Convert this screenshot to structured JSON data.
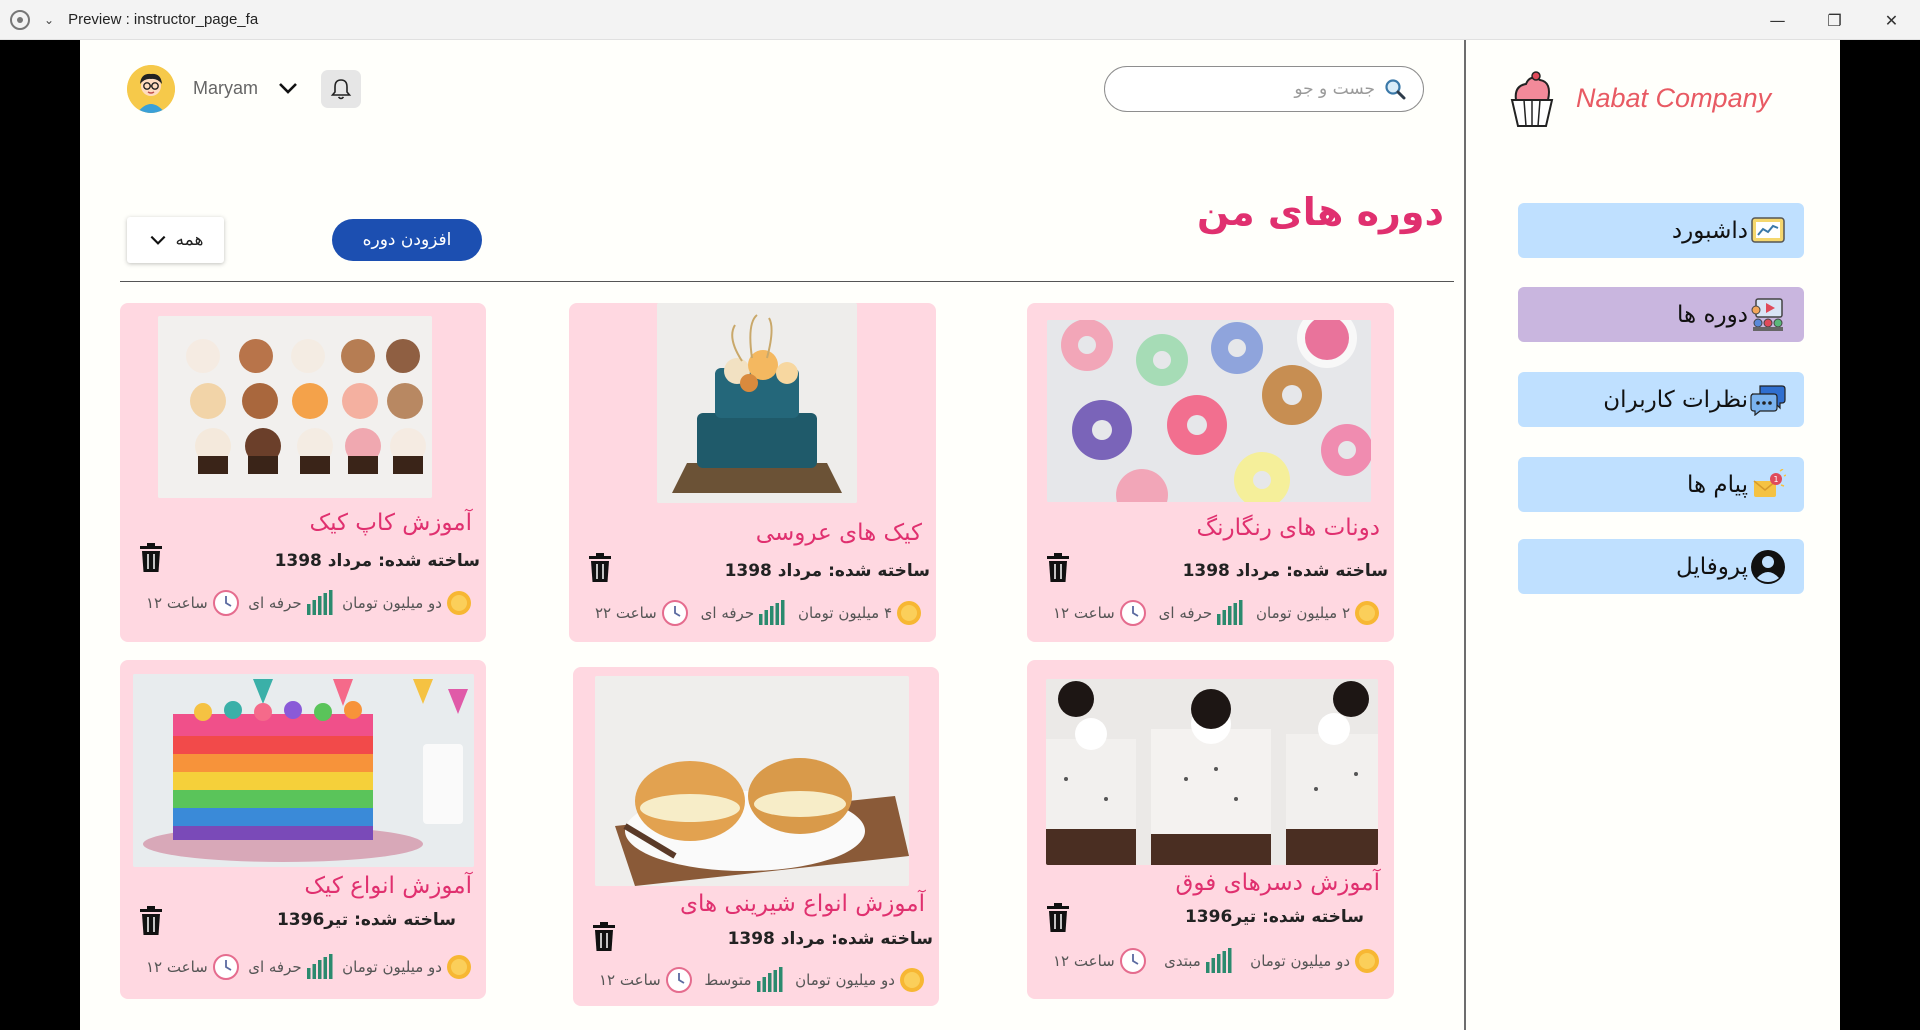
{
  "window": {
    "title": "Preview : instructor_page_fa"
  },
  "brand": {
    "name": "Nabat Company"
  },
  "nav": [
    {
      "label": "داشبورد",
      "icon": "dashboard-chart-icon",
      "active": false
    },
    {
      "label": "دوره ها",
      "icon": "courses-icon",
      "active": true
    },
    {
      "label": "نظرات کاربران",
      "icon": "comments-icon",
      "active": false
    },
    {
      "label": "پیام ها",
      "icon": "messages-icon",
      "active": false
    },
    {
      "label": "پروفایل",
      "icon": "profile-icon",
      "active": false
    }
  ],
  "header": {
    "user_name": "Maryam",
    "search_placeholder": "جست و جو"
  },
  "main": {
    "title": "دوره های من",
    "add_course_label": "افزودن دوره",
    "filter_label": "همه"
  },
  "courses": [
    {
      "title": "دونات های رنگارنگ",
      "date": "ساخته شده: مرداد 1398",
      "price": "۲ میلیون تومان",
      "level": "حرفه ای",
      "duration": "ساعت ۱۲"
    },
    {
      "title": "کیک های عروسی",
      "date": "ساخته شده: مرداد 1398",
      "price": "۴ میلیون تومان",
      "level": "حرفه ای",
      "duration": "ساعت ۲۲"
    },
    {
      "title": "آموزش کاپ کیک",
      "date": "ساخته شده: مرداد 1398",
      "price": "دو میلیون تومان",
      "level": "حرفه ای",
      "duration": "ساعت ۱۲"
    },
    {
      "title": "آموزش دسرهای فوق",
      "date": "ساخته شده: تیر1396",
      "price": "دو میلیون تومان",
      "level": "مبتدی",
      "duration": "ساعت ۱۲"
    },
    {
      "title": "آموزش انواع شیرینی های",
      "date": "ساخته شده: مرداد 1398",
      "price": "دو میلیون تومان",
      "level": "متوسط",
      "duration": "ساعت ۱۲"
    },
    {
      "title": "آموزش انواع کیک",
      "date": "ساخته شده: تیر1396",
      "price": "دو میلیون تومان",
      "level": "حرفه ای",
      "duration": "ساعت ۱۲"
    }
  ],
  "colors": {
    "accent": "#e0306f",
    "nav_bg": "#bfe0ff",
    "nav_active": "#c9b6df",
    "card_bg": "#ffd8e1",
    "button": "#1c4fb1",
    "brand": "#e85a63"
  }
}
